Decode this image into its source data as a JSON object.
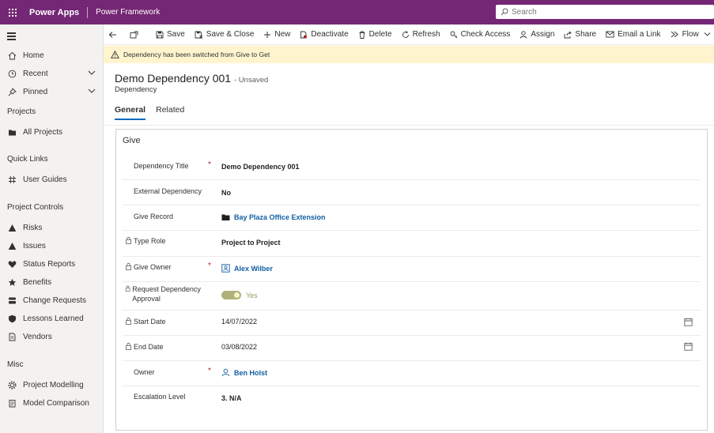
{
  "topbar": {
    "app_name": "Power Apps",
    "environment": "Power Framework",
    "search_placeholder": "Search",
    "color": "#742774"
  },
  "sidebar": {
    "items": [
      {
        "label": "Home",
        "icon": "home-icon"
      },
      {
        "label": "Recent",
        "icon": "clock-icon"
      },
      {
        "label": "Pinned",
        "icon": "pin-icon"
      }
    ],
    "sections": [
      {
        "title": "Projects",
        "items": [
          {
            "label": "All Projects",
            "icon": "folder-icon"
          }
        ]
      },
      {
        "title": "Quick Links",
        "items": [
          {
            "label": "User Guides",
            "icon": "grid-icon"
          }
        ]
      },
      {
        "title": "Project Controls",
        "items": [
          {
            "label": "Risks",
            "icon": "warning-icon"
          },
          {
            "label": "Issues",
            "icon": "warning-icon"
          },
          {
            "label": "Status Reports",
            "icon": "heart-icon"
          },
          {
            "label": "Benefits",
            "icon": "star-icon"
          },
          {
            "label": "Change Requests",
            "icon": "stack-icon"
          },
          {
            "label": "Lessons Learned",
            "icon": "shield-icon"
          },
          {
            "label": "Vendors",
            "icon": "document-icon"
          }
        ]
      },
      {
        "title": "Misc",
        "items": [
          {
            "label": "Project Modelling",
            "icon": "gear-icon"
          },
          {
            "label": "Model Comparison",
            "icon": "clipboard-icon"
          }
        ]
      }
    ]
  },
  "commands": [
    {
      "label": "Save",
      "icon": "save-icon"
    },
    {
      "label": "Save & Close",
      "icon": "save-close-icon"
    },
    {
      "label": "New",
      "icon": "plus-icon"
    },
    {
      "label": "Deactivate",
      "icon": "deactivate-icon"
    },
    {
      "label": "Delete",
      "icon": "trash-icon"
    },
    {
      "label": "Refresh",
      "icon": "refresh-icon"
    },
    {
      "label": "Check Access",
      "icon": "key-icon"
    },
    {
      "label": "Assign",
      "icon": "person-icon"
    },
    {
      "label": "Share",
      "icon": "share-icon"
    },
    {
      "label": "Email a Link",
      "icon": "mail-icon"
    },
    {
      "label": "Flow",
      "icon": "flow-icon"
    }
  ],
  "notification": {
    "message": "Dependency has been switched from Give to Get"
  },
  "record": {
    "title": "Demo Dependency 001",
    "status": "- Unsaved",
    "entity": "Dependency"
  },
  "tabs": [
    {
      "label": "General",
      "active": true
    },
    {
      "label": "Related",
      "active": false
    }
  ],
  "section": {
    "title": "Give",
    "fields": [
      {
        "label": "Dependency Title",
        "value": "Demo Dependency 001"
      },
      {
        "label": "External Dependency",
        "value": "No"
      },
      {
        "label": "Give Record",
        "value": "Bay Plaza Office Extension"
      },
      {
        "label": "Type Role",
        "value": "Project to Project"
      },
      {
        "label": "Give Owner",
        "value": "Alex Wilber"
      },
      {
        "label": "Request Dependency Approval",
        "value": "Yes"
      },
      {
        "label": "Start Date",
        "value": "14/07/2022"
      },
      {
        "label": "End Date",
        "value": "03/08/2022"
      },
      {
        "label": "Owner",
        "value": "Ben Holst"
      },
      {
        "label": "Escalation Level",
        "value": "3. N/A"
      }
    ],
    "required_marker": "*"
  },
  "colors": {
    "accent": "#0f6cbd",
    "link": "#115ea3",
    "required": "#a4262c",
    "highlight": "#ffff33",
    "notice_bg": "#fff4ce"
  }
}
